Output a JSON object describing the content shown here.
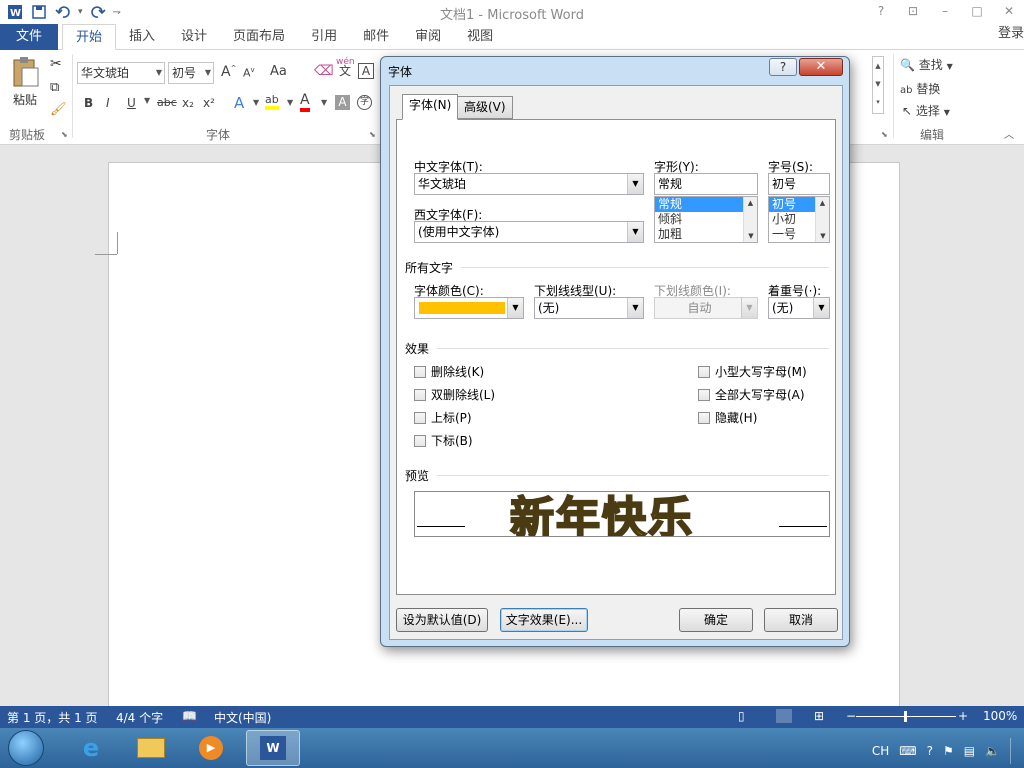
{
  "window": {
    "title": "文档1 - Microsoft Word",
    "controls": [
      "?",
      "⊡",
      "–",
      "□",
      "✕"
    ]
  },
  "qat": {
    "undo_arrow": "▾",
    "more": "⇁"
  },
  "ribbon_tabs": {
    "file": "文件",
    "tabs": [
      "开始",
      "插入",
      "设计",
      "页面布局",
      "引用",
      "邮件",
      "审阅",
      "视图"
    ],
    "active_index": 0,
    "signin": "登录"
  },
  "ribbon": {
    "clipboard": {
      "paste": "粘贴",
      "label": "剪贴板"
    },
    "font": {
      "font_name": "华文琥珀",
      "font_size": "初号",
      "grow": "A",
      "shrink": "A",
      "case": "Aa",
      "wen": "wén",
      "wen_char": "文",
      "box_a": "A",
      "bold": "B",
      "italic": "I",
      "underline": "U",
      "strike": "abc",
      "sub": "x₂",
      "sup": "x²",
      "effects_a": "A",
      "highlight": "ab",
      "color_a": "A",
      "shade_a": "A",
      "circle_char": "字",
      "label": "字体"
    },
    "editing": {
      "find": "查找",
      "replace": "替换",
      "select": "选择",
      "label": "编辑"
    }
  },
  "statusbar": {
    "page": "第 1 页，共 1 页",
    "words": "4/4 个字",
    "lang": "中文(中国)",
    "zoom": "100%"
  },
  "taskbar": {
    "tray_lang": "CH"
  },
  "dialog": {
    "title": "字体",
    "help": "?",
    "close": "✕",
    "tabs": [
      "字体(N)",
      "高级(V)"
    ],
    "cn_font_label": "中文字体(T):",
    "cn_font_value": "华文琥珀",
    "west_font_label": "西文字体(F):",
    "west_font_value": "(使用中文字体)",
    "style_label": "字形(Y):",
    "style_value": "常规",
    "style_list": [
      "常规",
      "倾斜",
      "加粗"
    ],
    "size_label": "字号(S):",
    "size_value": "初号",
    "size_list": [
      "初号",
      "小初",
      "一号"
    ],
    "all_text_label": "所有文字",
    "font_color_label": "字体颜色(C):",
    "font_color": "#ffc000",
    "underline_type_label": "下划线线型(U):",
    "underline_type_value": "(无)",
    "underline_color_label": "下划线颜色(I):",
    "underline_color_value": "自动",
    "emphasis_label": "着重号(·):",
    "emphasis_value": "(无)",
    "effects_label": "效果",
    "effects_left": [
      "删除线(K)",
      "双删除线(L)",
      "上标(P)",
      "下标(B)"
    ],
    "effects_right": [
      "小型大写字母(M)",
      "全部大写字母(A)",
      "隐藏(H)"
    ],
    "preview_label": "预览",
    "preview_text": "新年快乐",
    "btn_default": "设为默认值(D)",
    "btn_text_effects": "文字效果(E)...",
    "btn_ok": "确定",
    "btn_cancel": "取消"
  }
}
